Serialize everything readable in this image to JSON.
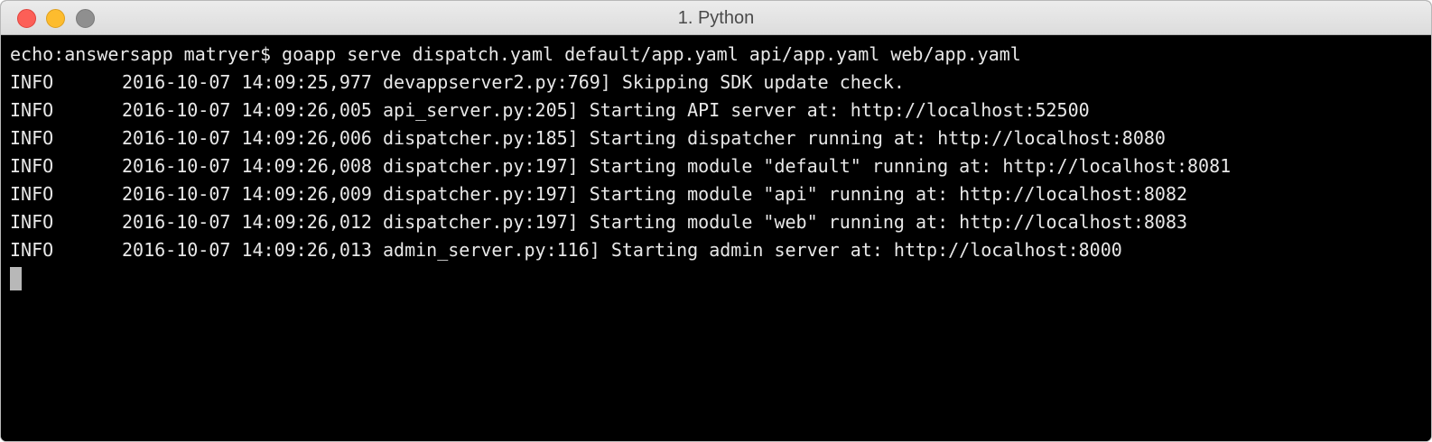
{
  "window": {
    "title": "1. Python"
  },
  "terminal": {
    "command_line": "echo:answersapp matryer$ goapp serve dispatch.yaml default/app.yaml api/app.yaml web/app.yaml",
    "log_lines": [
      {
        "level": "INFO",
        "text": "2016-10-07 14:09:25,977 devappserver2.py:769] Skipping SDK update check."
      },
      {
        "level": "INFO",
        "text": "2016-10-07 14:09:26,005 api_server.py:205] Starting API server at: http://localhost:52500"
      },
      {
        "level": "INFO",
        "text": "2016-10-07 14:09:26,006 dispatcher.py:185] Starting dispatcher running at: http://localhost:8080"
      },
      {
        "level": "INFO",
        "text": "2016-10-07 14:09:26,008 dispatcher.py:197] Starting module \"default\" running at: http://localhost:8081"
      },
      {
        "level": "INFO",
        "text": "2016-10-07 14:09:26,009 dispatcher.py:197] Starting module \"api\" running at: http://localhost:8082"
      },
      {
        "level": "INFO",
        "text": "2016-10-07 14:09:26,012 dispatcher.py:197] Starting module \"web\" running at: http://localhost:8083"
      },
      {
        "level": "INFO",
        "text": "2016-10-07 14:09:26,013 admin_server.py:116] Starting admin server at: http://localhost:8000"
      }
    ]
  },
  "colors": {
    "close": "#fc5f57",
    "minimize": "#fdbc2e",
    "zoom": "#8f8f8f",
    "terminal_bg": "#000000",
    "terminal_fg": "#e8e8e8"
  }
}
